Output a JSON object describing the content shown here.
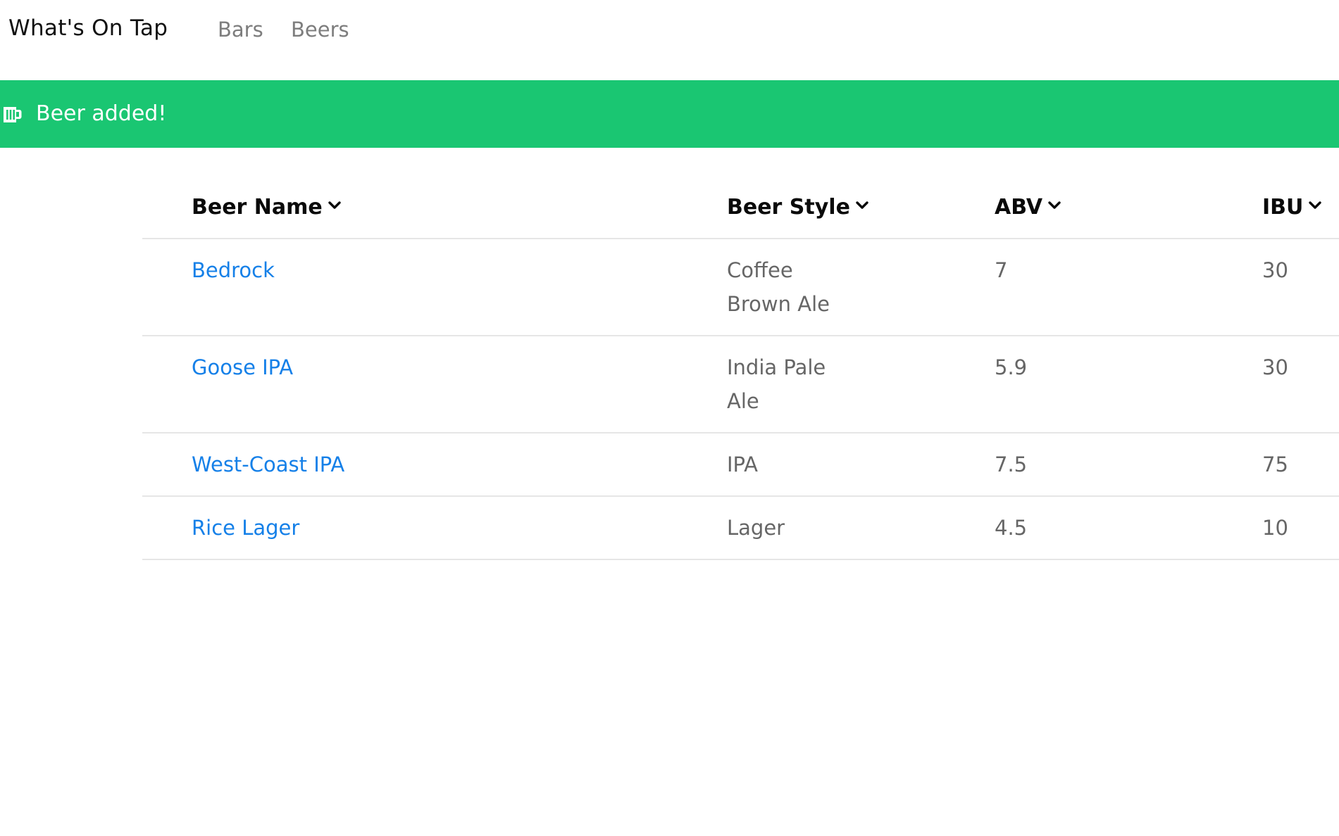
{
  "navbar": {
    "brand": "What's On Tap",
    "links": [
      {
        "label": "Bars"
      },
      {
        "label": "Beers"
      }
    ]
  },
  "flash": {
    "message": "Beer added!",
    "icon": "beer-mug-icon",
    "color": "#1ac672"
  },
  "table": {
    "headers": {
      "name": "Beer Name",
      "style": "Beer Style",
      "abv": "ABV",
      "ibu": "IBU"
    },
    "rows": [
      {
        "name": "Bedrock",
        "style": "Coffee Brown Ale",
        "abv": "7",
        "ibu": "30"
      },
      {
        "name": "Goose IPA",
        "style": "India Pale Ale",
        "abv": "5.9",
        "ibu": "30"
      },
      {
        "name": "West-Coast IPA",
        "style": "IPA",
        "abv": "7.5",
        "ibu": "75"
      },
      {
        "name": "Rice Lager",
        "style": "Lager",
        "abv": "4.5",
        "ibu": "10"
      }
    ]
  },
  "colors": {
    "link": "#1580e8",
    "text_muted": "#666666",
    "nav_muted": "#7d7d7d"
  }
}
